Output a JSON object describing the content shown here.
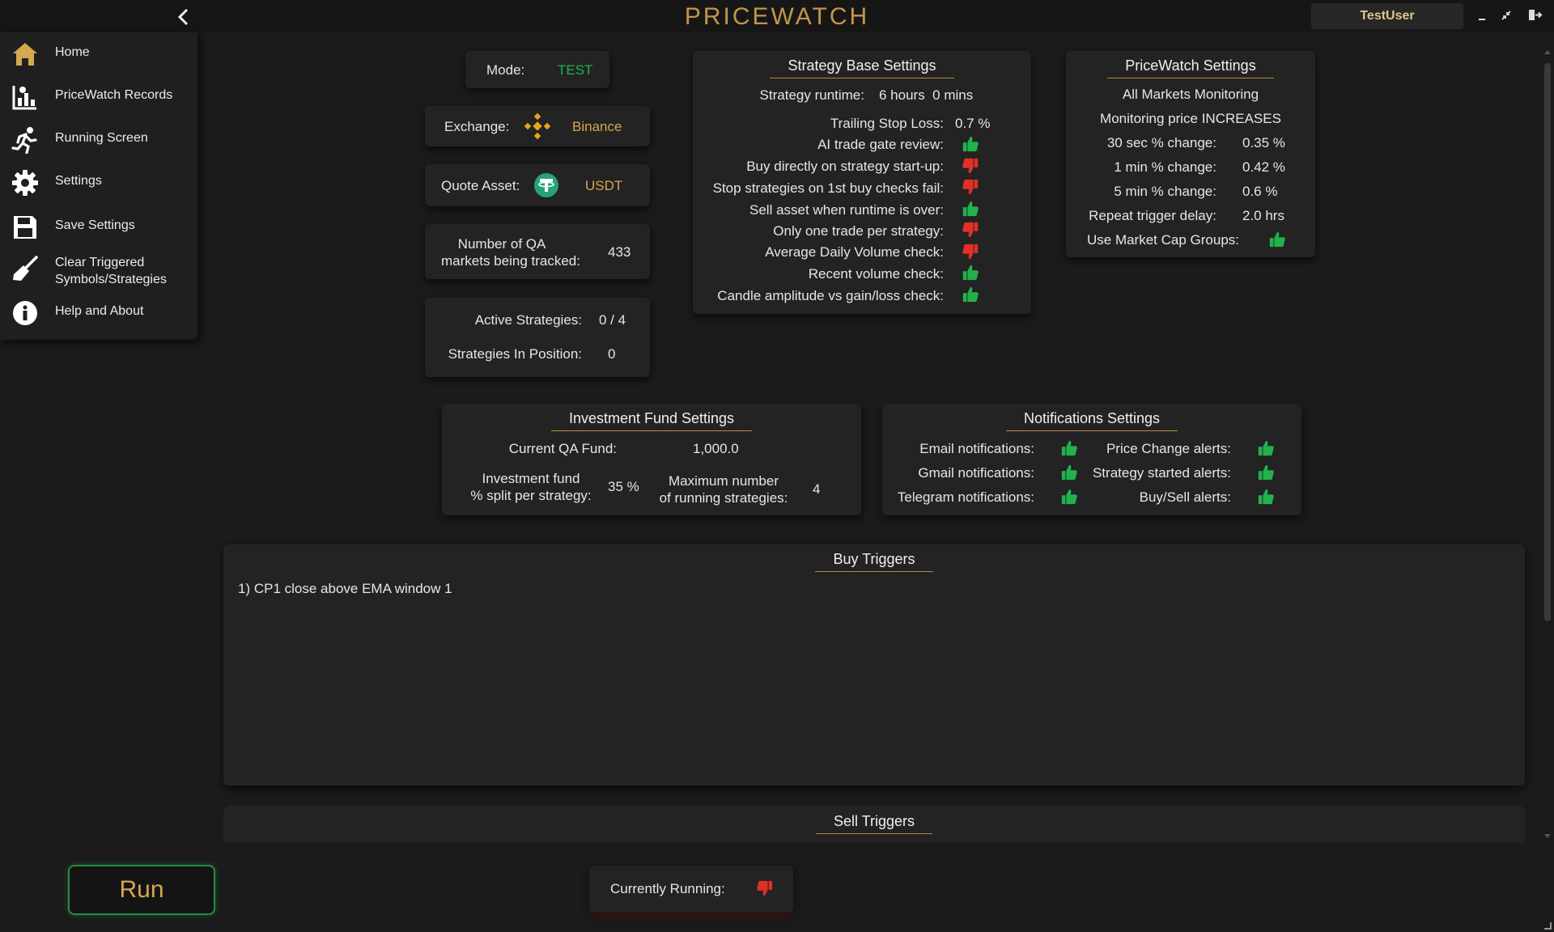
{
  "app": {
    "title": "PRICEWATCH",
    "user": "TestUser"
  },
  "sidebar": {
    "items": [
      {
        "label": "Home",
        "icon": "home-icon"
      },
      {
        "label": "PriceWatch Records",
        "icon": "records-icon"
      },
      {
        "label": "Running Screen",
        "icon": "running-icon"
      },
      {
        "label": "Settings",
        "icon": "gear-icon"
      },
      {
        "label": "Save Settings",
        "icon": "save-icon"
      },
      {
        "label": "Clear Triggered",
        "label2": "Symbols/Strategies",
        "icon": "broom-icon"
      },
      {
        "label": "Help and About",
        "icon": "info-icon"
      }
    ]
  },
  "status": {
    "mode_label": "Mode:",
    "mode_value": "TEST",
    "exchange_label": "Exchange:",
    "exchange_value": "Binance",
    "quote_label": "Quote Asset:",
    "quote_value": "USDT",
    "markets_label_1": "Number of QA",
    "markets_label_2": "markets being tracked:",
    "markets_value": "433",
    "active_label": "Active Strategies:",
    "active_value": "0 / 4",
    "inpos_label": "Strategies In Position:",
    "inpos_value": "0"
  },
  "strategy_base": {
    "title": "Strategy Base Settings",
    "runtime_label": "Strategy runtime:",
    "runtime_value": "6 hours  0 mins",
    "tsl_label": "Trailing Stop Loss:",
    "tsl_value": "0.7 %",
    "checks": [
      {
        "label": "AI trade gate review:",
        "value": "up"
      },
      {
        "label": "Buy directly on strategy start-up:",
        "value": "down"
      },
      {
        "label": "Stop strategies on 1st buy checks fail:",
        "value": "down"
      },
      {
        "label": "Sell asset when runtime is over:",
        "value": "up"
      },
      {
        "label": "Only one trade per strategy:",
        "value": "down"
      },
      {
        "label": "Average Daily Volume check:",
        "value": "down"
      },
      {
        "label": "Recent volume check:",
        "value": "up"
      },
      {
        "label": "Candle amplitude vs gain/loss check:",
        "value": "up"
      }
    ]
  },
  "pricewatch": {
    "title": "PriceWatch Settings",
    "line1": "All Markets Monitoring",
    "line2": "Monitoring price INCREASES",
    "rows": [
      {
        "label": "30 sec % change:",
        "value": "0.35 %"
      },
      {
        "label": "1 min % change:",
        "value": "0.42 %"
      },
      {
        "label": "5 min % change:",
        "value": "0.6 %"
      },
      {
        "label": "Repeat trigger delay:",
        "value": "2.0 hrs"
      }
    ],
    "mcg_label": "Use Market Cap Groups:",
    "mcg_value": "up"
  },
  "investment": {
    "title": "Investment Fund Settings",
    "fund_label": "Current QA Fund:",
    "fund_value": "1,000.0",
    "split_label_1": "Investment fund",
    "split_label_2": "% split per strategy:",
    "split_value": "35 %",
    "max_label_1": "Maximum number",
    "max_label_2": "of running strategies:",
    "max_value": "4"
  },
  "notifications": {
    "title": "Notifications Settings",
    "left": [
      {
        "label": "Email notifications:",
        "value": "up"
      },
      {
        "label": "Gmail notifications:",
        "value": "up"
      },
      {
        "label": "Telegram notifications:",
        "value": "up"
      }
    ],
    "right": [
      {
        "label": "Price Change alerts:",
        "value": "up"
      },
      {
        "label": "Strategy started alerts:",
        "value": "up"
      },
      {
        "label": "Buy/Sell alerts:",
        "value": "up"
      }
    ]
  },
  "buy_triggers": {
    "title": "Buy Triggers",
    "items": [
      "1) CP1 close above EMA window 1"
    ]
  },
  "sell_triggers": {
    "title": "Sell Triggers"
  },
  "footer": {
    "run_label": "Run",
    "running_label": "Currently Running:",
    "running_value": "down"
  },
  "colors": {
    "accent": "#d4a84e",
    "up": "#22b14c",
    "down": "#e0302a",
    "bg": "#1b1b1b",
    "panel": "#232323"
  }
}
